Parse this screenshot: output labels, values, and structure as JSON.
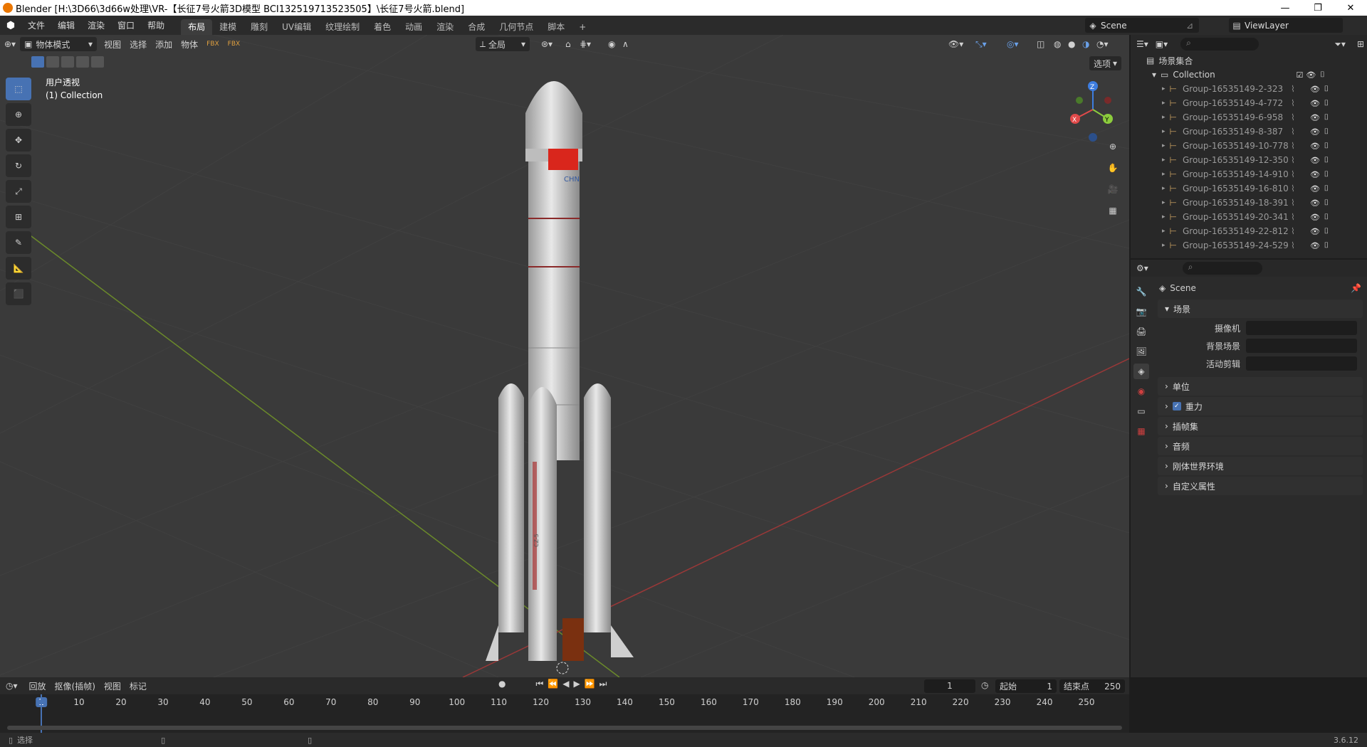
{
  "window": {
    "title": "Blender [H:\\3D66\\3d66w处理\\VR-【长征7号火箭3D模型 BCI132519713523505】\\长征7号火箭.blend]",
    "minimize": "—",
    "maximize": "❐",
    "close": "✕"
  },
  "menu": [
    "文件",
    "编辑",
    "渲染",
    "窗口",
    "帮助"
  ],
  "workspaces": [
    "布局",
    "建模",
    "雕刻",
    "UV编辑",
    "纹理绘制",
    "着色",
    "动画",
    "渲染",
    "合成",
    "几何节点",
    "脚本"
  ],
  "active_workspace": "布局",
  "add_workspace": "+",
  "scene_name": "Scene",
  "view_layer": "ViewLayer",
  "viewport": {
    "mode": "物体模式",
    "menus": [
      "视图",
      "选择",
      "添加",
      "物体"
    ],
    "transform_orientation": "全局",
    "options_label": "选项",
    "overlay_line1": "用户透视",
    "overlay_line2": "(1) Collection",
    "rocket_text": "CHN",
    "booster_text": "CZ-5"
  },
  "gizmo": {
    "x": "X",
    "y": "Y",
    "z": "Z"
  },
  "outliner": {
    "root": "场景集合",
    "collection": "Collection",
    "items": [
      "Group-16535149-2-323",
      "Group-16535149-4-772",
      "Group-16535149-6-958",
      "Group-16535149-8-387",
      "Group-16535149-10-778",
      "Group-16535149-12-350",
      "Group-16535149-14-910",
      "Group-16535149-16-810",
      "Group-16535149-18-391",
      "Group-16535149-20-341",
      "Group-16535149-22-812",
      "Group-16535149-24-529"
    ]
  },
  "properties": {
    "context_name": "Scene",
    "panel_scene": "场景",
    "fields": [
      {
        "label": "摄像机"
      },
      {
        "label": "背景场景"
      },
      {
        "label": "活动剪辑"
      }
    ],
    "sections": [
      "单位",
      "重力",
      "插帧集",
      "音频",
      "刚体世界环境",
      "自定义属性"
    ],
    "gravity_checked": true
  },
  "timeline": {
    "menus": [
      "回放",
      "抠像(插帧)",
      "视图",
      "标记"
    ],
    "current_frame": "1",
    "start_label": "起始",
    "start_value": "1",
    "end_label": "结束点",
    "end_value": "250",
    "ticks": [
      "1",
      "10",
      "20",
      "30",
      "40",
      "50",
      "60",
      "70",
      "80",
      "90",
      "100",
      "110",
      "120",
      "130",
      "140",
      "150",
      "160",
      "170",
      "180",
      "190",
      "200",
      "210",
      "220",
      "230",
      "240",
      "250"
    ]
  },
  "status": {
    "left": "选择",
    "version": "3.6.12"
  },
  "colors": {
    "accent": "#4772b3",
    "x_axis": "#e04a4a",
    "y_axis": "#8ccc3d",
    "z_axis": "#3d7de0",
    "playhead": "#4772b3"
  }
}
